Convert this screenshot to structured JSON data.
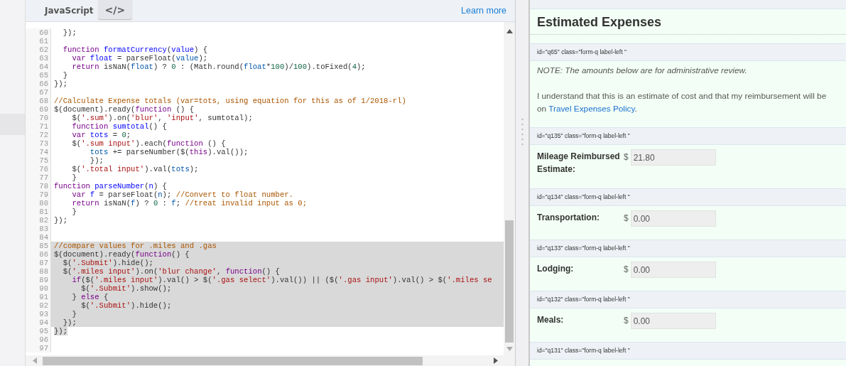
{
  "editor": {
    "language": "JavaScript",
    "view_toggle": "</>",
    "learn_more": "Learn more",
    "lines": [
      {
        "n": "60",
        "selected": false,
        "tokens": [
          {
            "kind": "p",
            "text": "  });"
          }
        ]
      },
      {
        "n": "61",
        "selected": false
      },
      {
        "n": "62",
        "selected": false,
        "tokens": [
          {
            "kind": "kw",
            "text": "  function"
          },
          {
            "kind": "def",
            "text": " formatCurrency"
          },
          {
            "kind": "p",
            "text": "("
          },
          {
            "kind": "def",
            "text": "value"
          },
          {
            "kind": "p",
            "text": ") {"
          }
        ]
      },
      {
        "n": "63",
        "selected": false,
        "tokens": [
          {
            "kind": "kw",
            "text": "    var"
          },
          {
            "kind": "def",
            "text": " float"
          },
          {
            "kind": "p",
            "text": " = parseFloat("
          },
          {
            "kind": "var",
            "text": "value"
          },
          {
            "kind": "p",
            "text": ");"
          }
        ]
      },
      {
        "n": "64",
        "selected": false,
        "tokens": [
          {
            "kind": "kw",
            "text": "    return"
          },
          {
            "kind": "p",
            "text": " isNaN("
          },
          {
            "kind": "var",
            "text": "float"
          },
          {
            "kind": "p",
            "text": ") ? "
          },
          {
            "kind": "num",
            "text": "0"
          },
          {
            "kind": "p",
            "text": " : (Math.round("
          },
          {
            "kind": "var",
            "text": "float"
          },
          {
            "kind": "p",
            "text": "*"
          },
          {
            "kind": "num",
            "text": "100"
          },
          {
            "kind": "p",
            "text": ")/"
          },
          {
            "kind": "num",
            "text": "100"
          },
          {
            "kind": "p",
            "text": ").toFixed("
          },
          {
            "kind": "num",
            "text": "4"
          },
          {
            "kind": "p",
            "text": ");"
          }
        ]
      },
      {
        "n": "65",
        "selected": false,
        "tokens": [
          {
            "kind": "p",
            "text": "  }"
          }
        ]
      },
      {
        "n": "66",
        "selected": false,
        "tokens": [
          {
            "kind": "p",
            "text": "});"
          }
        ]
      },
      {
        "n": "67",
        "selected": false
      },
      {
        "n": "68",
        "selected": false,
        "tokens": [
          {
            "kind": "com",
            "text": "//Calculate Expense totals (var=tots, using equation for this as of 1/2018-rl)"
          }
        ]
      },
      {
        "n": "69",
        "selected": false,
        "tokens": [
          {
            "kind": "p",
            "text": "$(document).ready("
          },
          {
            "kind": "kw",
            "text": "function"
          },
          {
            "kind": "p",
            "text": " () {"
          }
        ]
      },
      {
        "n": "70",
        "selected": false,
        "tokens": [
          {
            "kind": "p",
            "text": "    $("
          },
          {
            "kind": "str",
            "text": "'.sum'"
          },
          {
            "kind": "p",
            "text": ").on("
          },
          {
            "kind": "str",
            "text": "'blur'"
          },
          {
            "kind": "p",
            "text": ", "
          },
          {
            "kind": "str",
            "text": "'input'"
          },
          {
            "kind": "p",
            "text": ", sumtotal);"
          }
        ]
      },
      {
        "n": "71",
        "selected": false,
        "tokens": [
          {
            "kind": "kw",
            "text": "    function"
          },
          {
            "kind": "def",
            "text": " sumtotal"
          },
          {
            "kind": "p",
            "text": "() {"
          }
        ]
      },
      {
        "n": "72",
        "selected": false,
        "tokens": [
          {
            "kind": "kw",
            "text": "    var"
          },
          {
            "kind": "def",
            "text": " tots"
          },
          {
            "kind": "p",
            "text": " = "
          },
          {
            "kind": "num",
            "text": "0"
          },
          {
            "kind": "p",
            "text": ";"
          }
        ]
      },
      {
        "n": "73",
        "selected": false,
        "tokens": [
          {
            "kind": "p",
            "text": "    $("
          },
          {
            "kind": "str",
            "text": "'.sum input'"
          },
          {
            "kind": "p",
            "text": ").each("
          },
          {
            "kind": "kw",
            "text": "function"
          },
          {
            "kind": "p",
            "text": " () {"
          }
        ]
      },
      {
        "n": "74",
        "selected": false,
        "tokens": [
          {
            "kind": "var",
            "text": "        tots"
          },
          {
            "kind": "p",
            "text": " += parseNumber($("
          },
          {
            "kind": "kw",
            "text": "this"
          },
          {
            "kind": "p",
            "text": ").val());"
          }
        ]
      },
      {
        "n": "75",
        "selected": false,
        "tokens": [
          {
            "kind": "p",
            "text": "        });"
          }
        ]
      },
      {
        "n": "76",
        "selected": false,
        "tokens": [
          {
            "kind": "p",
            "text": "    $("
          },
          {
            "kind": "str",
            "text": "'.total input'"
          },
          {
            "kind": "p",
            "text": ").val("
          },
          {
            "kind": "var",
            "text": "tots"
          },
          {
            "kind": "p",
            "text": ");"
          }
        ]
      },
      {
        "n": "77",
        "selected": false,
        "tokens": [
          {
            "kind": "p",
            "text": "    }"
          }
        ]
      },
      {
        "n": "78",
        "selected": false,
        "tokens": [
          {
            "kind": "kw",
            "text": "function"
          },
          {
            "kind": "def",
            "text": " parseNumber"
          },
          {
            "kind": "p",
            "text": "("
          },
          {
            "kind": "def",
            "text": "n"
          },
          {
            "kind": "p",
            "text": ") {"
          }
        ]
      },
      {
        "n": "79",
        "selected": false,
        "tokens": [
          {
            "kind": "kw",
            "text": "    var"
          },
          {
            "kind": "def",
            "text": " f"
          },
          {
            "kind": "p",
            "text": " = parseFloat("
          },
          {
            "kind": "var",
            "text": "n"
          },
          {
            "kind": "p",
            "text": "); "
          },
          {
            "kind": "com",
            "text": "//Convert to float number."
          }
        ]
      },
      {
        "n": "80",
        "selected": false,
        "tokens": [
          {
            "kind": "kw",
            "text": "    return"
          },
          {
            "kind": "p",
            "text": " isNaN("
          },
          {
            "kind": "var",
            "text": "f"
          },
          {
            "kind": "p",
            "text": ") ? "
          },
          {
            "kind": "num",
            "text": "0"
          },
          {
            "kind": "p",
            "text": " : "
          },
          {
            "kind": "var",
            "text": "f"
          },
          {
            "kind": "p",
            "text": "; "
          },
          {
            "kind": "com",
            "text": "//treat invalid input as 0;"
          }
        ]
      },
      {
        "n": "81",
        "selected": false,
        "tokens": [
          {
            "kind": "p",
            "text": "    }"
          }
        ]
      },
      {
        "n": "82",
        "selected": false,
        "tokens": [
          {
            "kind": "p",
            "text": "});"
          }
        ]
      },
      {
        "n": "83",
        "selected": false
      },
      {
        "n": "84",
        "selected": false
      },
      {
        "n": "85",
        "selected": true,
        "tokens": [
          {
            "kind": "com",
            "text": "//compare values for .miles and .gas"
          }
        ]
      },
      {
        "n": "86",
        "selected": true,
        "tokens": [
          {
            "kind": "p",
            "text": "$(document).ready("
          },
          {
            "kind": "kw",
            "text": "function"
          },
          {
            "kind": "p",
            "text": "() {"
          }
        ]
      },
      {
        "n": "87",
        "selected": true,
        "tokens": [
          {
            "kind": "p",
            "text": "  $("
          },
          {
            "kind": "str",
            "text": "'.Submit'"
          },
          {
            "kind": "p",
            "text": ").hide();"
          }
        ]
      },
      {
        "n": "88",
        "selected": true,
        "tokens": [
          {
            "kind": "p",
            "text": "  $("
          },
          {
            "kind": "str",
            "text": "'.miles input'"
          },
          {
            "kind": "p",
            "text": ").on("
          },
          {
            "kind": "str",
            "text": "'blur change'"
          },
          {
            "kind": "p",
            "text": ", "
          },
          {
            "kind": "kw",
            "text": "function"
          },
          {
            "kind": "p",
            "text": "() {"
          }
        ]
      },
      {
        "n": "89",
        "selected": true,
        "tokens": [
          {
            "kind": "kw",
            "text": "    if"
          },
          {
            "kind": "p",
            "text": "($("
          },
          {
            "kind": "str",
            "text": "'.miles input'"
          },
          {
            "kind": "p",
            "text": ").val() > $("
          },
          {
            "kind": "str",
            "text": "'.gas select'"
          },
          {
            "kind": "p",
            "text": ").val()) || ($("
          },
          {
            "kind": "str",
            "text": "'.gas input'"
          },
          {
            "kind": "p",
            "text": ").val() > $("
          },
          {
            "kind": "str",
            "text": "'.miles se"
          }
        ]
      },
      {
        "n": "90",
        "selected": true,
        "tokens": [
          {
            "kind": "p",
            "text": "      $("
          },
          {
            "kind": "str",
            "text": "'.Submit'"
          },
          {
            "kind": "p",
            "text": ").show();"
          }
        ]
      },
      {
        "n": "91",
        "selected": true,
        "tokens": [
          {
            "kind": "p",
            "text": "    } "
          },
          {
            "kind": "kw",
            "text": "else"
          },
          {
            "kind": "p",
            "text": " {"
          }
        ]
      },
      {
        "n": "92",
        "selected": true,
        "tokens": [
          {
            "kind": "p",
            "text": "      $("
          },
          {
            "kind": "str",
            "text": "'.Submit'"
          },
          {
            "kind": "p",
            "text": ").hide();"
          }
        ]
      },
      {
        "n": "93",
        "selected": true,
        "tokens": [
          {
            "kind": "p",
            "text": "    }"
          }
        ]
      },
      {
        "n": "94",
        "selected": true,
        "tokens": [
          {
            "kind": "p",
            "text": "  });"
          }
        ]
      },
      {
        "n": "95",
        "selected": true,
        "tokens": [
          {
            "kind": "p",
            "text": "});"
          }
        ]
      },
      {
        "n": "96",
        "selected": false
      },
      {
        "n": "97",
        "selected": false
      }
    ]
  },
  "form": {
    "section_title": "Estimated Expenses",
    "blocks": [
      {
        "kind": "note",
        "tag": "id=\"q65\" class=\"form-q label-left \"",
        "note": "NOTE: The amounts below are for administrative review.",
        "text": "I understand that this is an estimate of cost and that my reimbursement will be",
        "text_2": "on ",
        "link": "Travel Expenses Policy",
        "text_end": "."
      },
      {
        "kind": "amount",
        "tag": "id=\"q135\" class=\"form-q label-left \"",
        "label": "Mileage Reimbursed Estimate:",
        "currency": "$",
        "value": "21.80"
      },
      {
        "kind": "amount",
        "tag": "id=\"q134\" class=\"form-q label-left \"",
        "label": "Transportation:",
        "currency": "$",
        "value": "0.00"
      },
      {
        "kind": "amount",
        "tag": "id=\"q133\" class=\"form-q label-left \"",
        "label": "Lodging:",
        "currency": "$",
        "value": "0.00"
      },
      {
        "kind": "amount",
        "tag": "id=\"q132\" class=\"form-q label-left \"",
        "label": "Meals:",
        "currency": "$",
        "value": "0.00"
      },
      {
        "kind": "tag_only",
        "tag": "id=\"q131\" class=\"form-q label-left \""
      }
    ]
  }
}
